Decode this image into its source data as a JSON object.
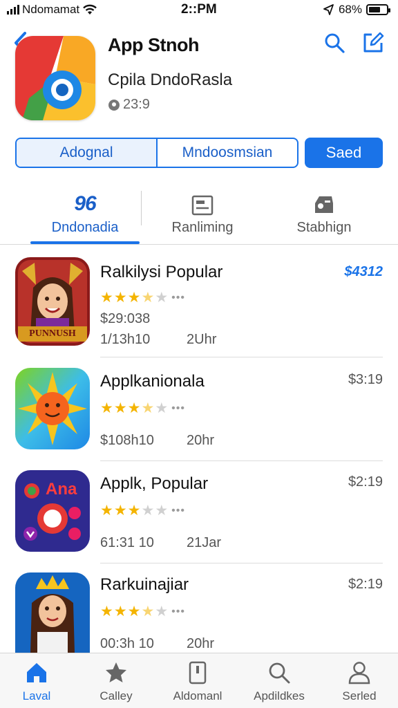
{
  "status_bar": {
    "carrier": "Ndomamat",
    "time": "2::PM",
    "battery_text": "68%",
    "battery_level": 0.68
  },
  "header": {
    "title": "App Stnoh",
    "subtitle": "Cpila DndoRasla",
    "meta": "23:9",
    "back_icon": "chevron-left-icon",
    "search_icon": "search-icon",
    "edit_icon": "compose-icon"
  },
  "segmented": {
    "options": [
      "Adognal",
      "Mndoosmsian"
    ],
    "selected": 0
  },
  "primary_button": {
    "label": "Saed"
  },
  "tabs": [
    {
      "badge": "96",
      "label": "Dndonadia",
      "active": true
    },
    {
      "badge": "",
      "label": "Ranliming",
      "icon": "ranking-icon",
      "active": false
    },
    {
      "badge": "",
      "label": "Stabhign",
      "icon": "stack-icon",
      "active": false
    }
  ],
  "list": [
    {
      "title": "Ralkilysi Popular",
      "price": "$4312",
      "rating_stars": 3.5,
      "line1": "$29:038",
      "meta_a": "1/13h10",
      "meta_b": "2Uhr",
      "icon_text": "PUNNUSH"
    },
    {
      "title": "Applkanionala",
      "price": "$3:19",
      "rating_stars": 3.5,
      "line1": "",
      "meta_a": "$108h10",
      "meta_b": "20hr",
      "icon_text": ""
    },
    {
      "title": "Applk, Popular",
      "price": "$2:19",
      "rating_stars": 3,
      "line1": "",
      "meta_a": "61:31 10",
      "meta_b": "21Jar",
      "icon_text": "Ana"
    },
    {
      "title": "Rarkuinajiar",
      "price": "$2:19",
      "rating_stars": 3.5,
      "line1": "",
      "meta_a": "00:3h 10",
      "meta_b": "20hr",
      "icon_text": ""
    }
  ],
  "bottom_nav": [
    {
      "label": "Laval",
      "icon": "home-icon",
      "active": true
    },
    {
      "label": "Calley",
      "icon": "star-icon",
      "active": false
    },
    {
      "label": "Aldomanl",
      "icon": "tablet-icon",
      "active": false
    },
    {
      "label": "Apdildkes",
      "icon": "search-icon",
      "active": false
    },
    {
      "label": "Serled",
      "icon": "person-icon",
      "active": false
    }
  ],
  "colors": {
    "accent": "#1a73e8",
    "star": "#f4b400",
    "text": "#111111",
    "muted": "#555555"
  }
}
